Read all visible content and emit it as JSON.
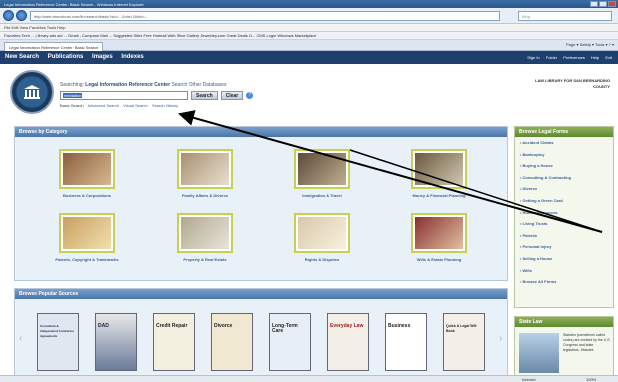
{
  "window": {
    "title": "Legal Information Reference Center: Basic Search - Windows Internet Explorer"
  },
  "browser": {
    "url": "http://web.ebscohost.com/lirc/search/basic?sid=...&vid=1&hid=...",
    "search_placeholder": "Bing",
    "menu": "File  Edit  View  Favorites  Tools  Help",
    "favorites": "Favorites    Tech ... | library ads aol ...  Gmail - Compose Mail ...  Suggested Sites  Free Hotmail  Web Slice Gallery  Jeweldey.com Great Deals O...  CMS Login  Windows Marketplace",
    "tab_label": "Legal Information Reference Center: Basic Search",
    "tab_tools": "Page ▾  Safety ▾  Tools ▾  ? ▾"
  },
  "sitenav": {
    "items": [
      "New Search",
      "Publications",
      "Images",
      "Indexes"
    ],
    "right": [
      "Sign In",
      "Folder",
      "Preferences",
      "Help",
      "Exit"
    ]
  },
  "search": {
    "label_prefix": "Searching:",
    "database": "Legal Information Reference Center",
    "choose": "Search Other Databases",
    "query": "mediation",
    "search_button": "Search",
    "clear_button": "Clear",
    "help": "?",
    "links": [
      "Basic Search",
      "Advanced Search",
      "Visual Search",
      "Search History"
    ]
  },
  "library_name": "LAW LIBRARY FOR SAN BERNARDINO COUNTY",
  "categories": {
    "title": "Browse by Category",
    "items": [
      {
        "label": "Business & Corporations"
      },
      {
        "label": "Family Affairs & Divorce"
      },
      {
        "label": "Immigration & Travel"
      },
      {
        "label": "Money & Financial Planning"
      },
      {
        "label": "Patents, Copyright & Trademarks"
      },
      {
        "label": "Property & Real Estate"
      },
      {
        "label": "Rights & Disputes"
      },
      {
        "label": "Wills & Estate Planning"
      }
    ]
  },
  "popular": {
    "title": "Browse Popular Sources",
    "books": [
      "Consultant & Independent Contractor Agreements",
      "DAD",
      "Credit Repair",
      "Divorce",
      "Long-Term Care",
      "Everyday Law",
      "Business",
      "Quick & Legal Will Book"
    ]
  },
  "legal_forms": {
    "title": "Browse Legal Forms",
    "items": [
      "Accident Claims",
      "Bankruptcy",
      "Buying a House",
      "Consulting & Contracting",
      "Divorce",
      "Getting a Green Card",
      "Human Resources",
      "Living Trusts",
      "Patents",
      "Personal Injury",
      "Selling a House",
      "Wills",
      "Browse All Forms"
    ]
  },
  "state_law": {
    "title": "State Law",
    "text": "Statutes (sometimes called codes) are created by the U.S. Congress and state legislators. Statutes"
  },
  "status": {
    "zone": "Internet",
    "zoom": "100%"
  }
}
